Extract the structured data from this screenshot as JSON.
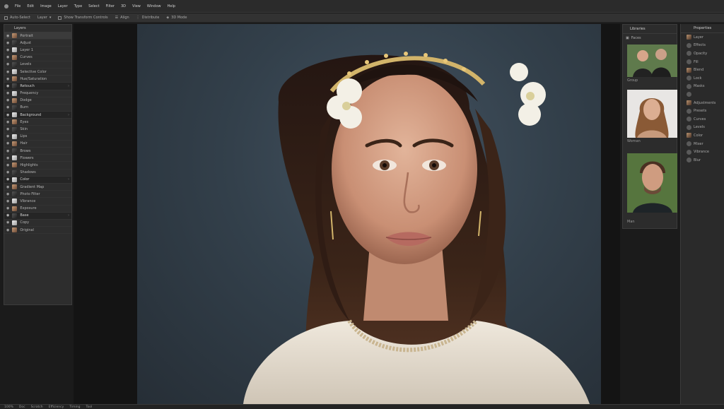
{
  "menubar": {
    "items": [
      "File",
      "Edit",
      "Image",
      "Layer",
      "Type",
      "Select",
      "Filter",
      "3D",
      "View",
      "Window",
      "Help"
    ]
  },
  "options_bar": {
    "items": [
      "Auto-Select",
      "Layer",
      "Show Transform Controls",
      "Align",
      "Distribute",
      "3D Mode"
    ]
  },
  "left_panel": {
    "title": "Layers",
    "rows": [
      {
        "label": "Portrait",
        "type": "sel"
      },
      {
        "label": "Adjust"
      },
      {
        "label": "Layer 1"
      },
      {
        "label": "Curves"
      },
      {
        "label": "Levels"
      },
      {
        "label": "Selective Color"
      },
      {
        "label": "Hue/Saturation"
      },
      {
        "label": "Retouch",
        "type": "group"
      },
      {
        "label": "Frequency"
      },
      {
        "label": "Dodge"
      },
      {
        "label": "Burn"
      },
      {
        "label": "Background",
        "type": "group"
      },
      {
        "label": "Eyes"
      },
      {
        "label": "Skin"
      },
      {
        "label": "Lips"
      },
      {
        "label": "Hair"
      },
      {
        "label": "Brows"
      },
      {
        "label": "Flowers"
      },
      {
        "label": "Highlights"
      },
      {
        "label": "Shadows"
      },
      {
        "label": "Color",
        "type": "group"
      },
      {
        "label": "Gradient Map"
      },
      {
        "label": "Photo Filter"
      },
      {
        "label": "Vibrance"
      },
      {
        "label": "Exposure"
      },
      {
        "label": "Base",
        "type": "group"
      },
      {
        "label": "Copy"
      },
      {
        "label": "Original"
      }
    ]
  },
  "right_panel": {
    "title": "Libraries",
    "subtitle": "Faces",
    "thumbs": [
      {
        "caption": "Group"
      },
      {
        "caption": "Woman"
      },
      {
        "caption": "Man"
      }
    ]
  },
  "far_panel": {
    "title": "Properties",
    "rows": [
      "Layer",
      "Effects",
      "Opacity",
      "Fill",
      "Blend",
      "Lock",
      "Masks",
      "",
      "Adjustments",
      "Presets",
      "Curves",
      "Levels",
      "Color",
      "Mixer",
      "Vibrance",
      "Blur"
    ]
  },
  "status": {
    "items": [
      "100%",
      "Doc",
      "Scratch",
      "Efficiency",
      "Timing",
      "Tool"
    ]
  },
  "colors": {
    "background": "#2d3842",
    "panel": "#2d2d2d",
    "accent": "#d2b46a"
  }
}
